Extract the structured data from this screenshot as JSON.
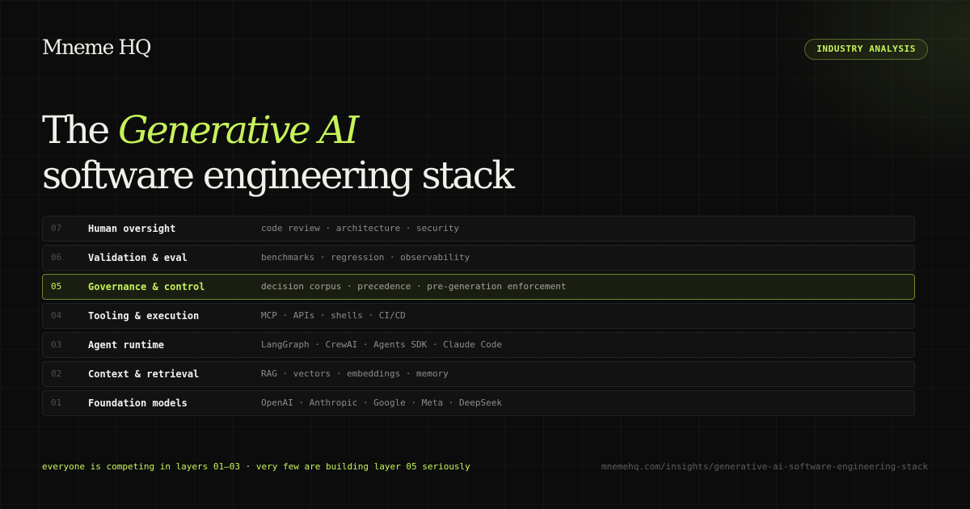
{
  "brand": "Mneme HQ",
  "badge": "INDUSTRY ANALYSIS",
  "headline": {
    "prefix": "The ",
    "accent": "Generative AI",
    "line2": "software engineering stack"
  },
  "layers": [
    {
      "num": "07",
      "name": "Human oversight",
      "desc": "code review · architecture · security"
    },
    {
      "num": "06",
      "name": "Validation & eval",
      "desc": "benchmarks · regression · observability"
    },
    {
      "num": "05",
      "name": "Governance & control",
      "desc": "decision corpus · precedence · pre-generation enforcement"
    },
    {
      "num": "04",
      "name": "Tooling & execution",
      "desc": "MCP · APIs · shells · CI/CD"
    },
    {
      "num": "03",
      "name": "Agent runtime",
      "desc": "LangGraph · CrewAI · Agents SDK · Claude Code"
    },
    {
      "num": "02",
      "name": "Context & retrieval",
      "desc": "RAG · vectors · embeddings · memory"
    },
    {
      "num": "01",
      "name": "Foundation models",
      "desc": "OpenAI · Anthropic · Google · Meta · DeepSeek"
    }
  ],
  "footer": {
    "tagline": "everyone is competing in layers 01–03 · very few are building layer 05 seriously",
    "url": "mnemehq.com/insights/generative-ai-software-engineering-stack"
  },
  "colors": {
    "accent": "#c6f25a",
    "background": "#0c0c0c"
  }
}
